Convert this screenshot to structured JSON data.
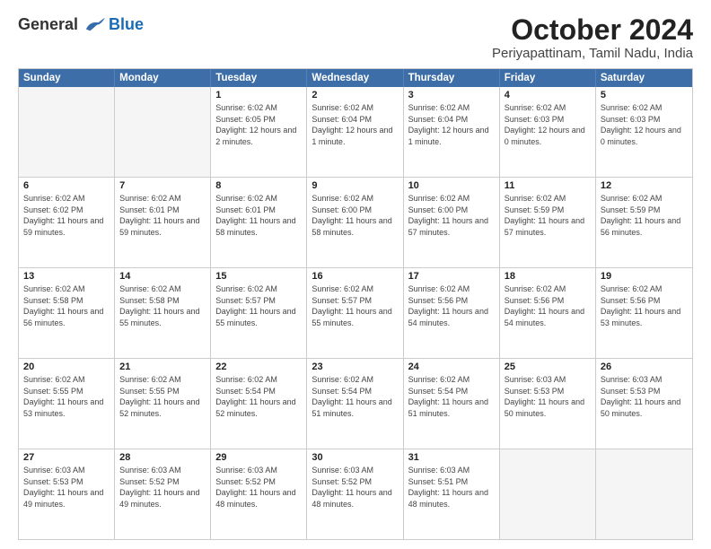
{
  "logo": {
    "general": "General",
    "blue": "Blue"
  },
  "title": "October 2024",
  "location": "Periyapattinam, Tamil Nadu, India",
  "headers": [
    "Sunday",
    "Monday",
    "Tuesday",
    "Wednesday",
    "Thursday",
    "Friday",
    "Saturday"
  ],
  "rows": [
    [
      {
        "date": "",
        "sunrise": "",
        "sunset": "",
        "daylight": "",
        "empty": true
      },
      {
        "date": "",
        "sunrise": "",
        "sunset": "",
        "daylight": "",
        "empty": true
      },
      {
        "date": "1",
        "sunrise": "Sunrise: 6:02 AM",
        "sunset": "Sunset: 6:05 PM",
        "daylight": "Daylight: 12 hours and 2 minutes.",
        "empty": false
      },
      {
        "date": "2",
        "sunrise": "Sunrise: 6:02 AM",
        "sunset": "Sunset: 6:04 PM",
        "daylight": "Daylight: 12 hours and 1 minute.",
        "empty": false
      },
      {
        "date": "3",
        "sunrise": "Sunrise: 6:02 AM",
        "sunset": "Sunset: 6:04 PM",
        "daylight": "Daylight: 12 hours and 1 minute.",
        "empty": false
      },
      {
        "date": "4",
        "sunrise": "Sunrise: 6:02 AM",
        "sunset": "Sunset: 6:03 PM",
        "daylight": "Daylight: 12 hours and 0 minutes.",
        "empty": false
      },
      {
        "date": "5",
        "sunrise": "Sunrise: 6:02 AM",
        "sunset": "Sunset: 6:03 PM",
        "daylight": "Daylight: 12 hours and 0 minutes.",
        "empty": false
      }
    ],
    [
      {
        "date": "6",
        "sunrise": "Sunrise: 6:02 AM",
        "sunset": "Sunset: 6:02 PM",
        "daylight": "Daylight: 11 hours and 59 minutes.",
        "empty": false
      },
      {
        "date": "7",
        "sunrise": "Sunrise: 6:02 AM",
        "sunset": "Sunset: 6:01 PM",
        "daylight": "Daylight: 11 hours and 59 minutes.",
        "empty": false
      },
      {
        "date": "8",
        "sunrise": "Sunrise: 6:02 AM",
        "sunset": "Sunset: 6:01 PM",
        "daylight": "Daylight: 11 hours and 58 minutes.",
        "empty": false
      },
      {
        "date": "9",
        "sunrise": "Sunrise: 6:02 AM",
        "sunset": "Sunset: 6:00 PM",
        "daylight": "Daylight: 11 hours and 58 minutes.",
        "empty": false
      },
      {
        "date": "10",
        "sunrise": "Sunrise: 6:02 AM",
        "sunset": "Sunset: 6:00 PM",
        "daylight": "Daylight: 11 hours and 57 minutes.",
        "empty": false
      },
      {
        "date": "11",
        "sunrise": "Sunrise: 6:02 AM",
        "sunset": "Sunset: 5:59 PM",
        "daylight": "Daylight: 11 hours and 57 minutes.",
        "empty": false
      },
      {
        "date": "12",
        "sunrise": "Sunrise: 6:02 AM",
        "sunset": "Sunset: 5:59 PM",
        "daylight": "Daylight: 11 hours and 56 minutes.",
        "empty": false
      }
    ],
    [
      {
        "date": "13",
        "sunrise": "Sunrise: 6:02 AM",
        "sunset": "Sunset: 5:58 PM",
        "daylight": "Daylight: 11 hours and 56 minutes.",
        "empty": false
      },
      {
        "date": "14",
        "sunrise": "Sunrise: 6:02 AM",
        "sunset": "Sunset: 5:58 PM",
        "daylight": "Daylight: 11 hours and 55 minutes.",
        "empty": false
      },
      {
        "date": "15",
        "sunrise": "Sunrise: 6:02 AM",
        "sunset": "Sunset: 5:57 PM",
        "daylight": "Daylight: 11 hours and 55 minutes.",
        "empty": false
      },
      {
        "date": "16",
        "sunrise": "Sunrise: 6:02 AM",
        "sunset": "Sunset: 5:57 PM",
        "daylight": "Daylight: 11 hours and 55 minutes.",
        "empty": false
      },
      {
        "date": "17",
        "sunrise": "Sunrise: 6:02 AM",
        "sunset": "Sunset: 5:56 PM",
        "daylight": "Daylight: 11 hours and 54 minutes.",
        "empty": false
      },
      {
        "date": "18",
        "sunrise": "Sunrise: 6:02 AM",
        "sunset": "Sunset: 5:56 PM",
        "daylight": "Daylight: 11 hours and 54 minutes.",
        "empty": false
      },
      {
        "date": "19",
        "sunrise": "Sunrise: 6:02 AM",
        "sunset": "Sunset: 5:56 PM",
        "daylight": "Daylight: 11 hours and 53 minutes.",
        "empty": false
      }
    ],
    [
      {
        "date": "20",
        "sunrise": "Sunrise: 6:02 AM",
        "sunset": "Sunset: 5:55 PM",
        "daylight": "Daylight: 11 hours and 53 minutes.",
        "empty": false
      },
      {
        "date": "21",
        "sunrise": "Sunrise: 6:02 AM",
        "sunset": "Sunset: 5:55 PM",
        "daylight": "Daylight: 11 hours and 52 minutes.",
        "empty": false
      },
      {
        "date": "22",
        "sunrise": "Sunrise: 6:02 AM",
        "sunset": "Sunset: 5:54 PM",
        "daylight": "Daylight: 11 hours and 52 minutes.",
        "empty": false
      },
      {
        "date": "23",
        "sunrise": "Sunrise: 6:02 AM",
        "sunset": "Sunset: 5:54 PM",
        "daylight": "Daylight: 11 hours and 51 minutes.",
        "empty": false
      },
      {
        "date": "24",
        "sunrise": "Sunrise: 6:02 AM",
        "sunset": "Sunset: 5:54 PM",
        "daylight": "Daylight: 11 hours and 51 minutes.",
        "empty": false
      },
      {
        "date": "25",
        "sunrise": "Sunrise: 6:03 AM",
        "sunset": "Sunset: 5:53 PM",
        "daylight": "Daylight: 11 hours and 50 minutes.",
        "empty": false
      },
      {
        "date": "26",
        "sunrise": "Sunrise: 6:03 AM",
        "sunset": "Sunset: 5:53 PM",
        "daylight": "Daylight: 11 hours and 50 minutes.",
        "empty": false
      }
    ],
    [
      {
        "date": "27",
        "sunrise": "Sunrise: 6:03 AM",
        "sunset": "Sunset: 5:53 PM",
        "daylight": "Daylight: 11 hours and 49 minutes.",
        "empty": false
      },
      {
        "date": "28",
        "sunrise": "Sunrise: 6:03 AM",
        "sunset": "Sunset: 5:52 PM",
        "daylight": "Daylight: 11 hours and 49 minutes.",
        "empty": false
      },
      {
        "date": "29",
        "sunrise": "Sunrise: 6:03 AM",
        "sunset": "Sunset: 5:52 PM",
        "daylight": "Daylight: 11 hours and 48 minutes.",
        "empty": false
      },
      {
        "date": "30",
        "sunrise": "Sunrise: 6:03 AM",
        "sunset": "Sunset: 5:52 PM",
        "daylight": "Daylight: 11 hours and 48 minutes.",
        "empty": false
      },
      {
        "date": "31",
        "sunrise": "Sunrise: 6:03 AM",
        "sunset": "Sunset: 5:51 PM",
        "daylight": "Daylight: 11 hours and 48 minutes.",
        "empty": false
      },
      {
        "date": "",
        "sunrise": "",
        "sunset": "",
        "daylight": "",
        "empty": true
      },
      {
        "date": "",
        "sunrise": "",
        "sunset": "",
        "daylight": "",
        "empty": true
      }
    ]
  ]
}
